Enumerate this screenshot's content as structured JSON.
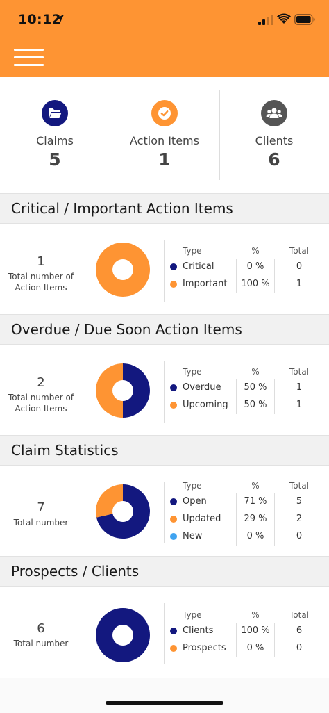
{
  "status_bar": {
    "time": "10:12"
  },
  "colors": {
    "header": "#fe9433",
    "navy": "#13187f",
    "orange": "#fe9433",
    "light_blue": "#3fa3f0",
    "gray_icon": "#555555"
  },
  "summary": [
    {
      "label": "Claims",
      "value": "5",
      "icon": "folder-open-icon"
    },
    {
      "label": "Action Items",
      "value": "1",
      "icon": "check-circle-icon"
    },
    {
      "label": "Clients",
      "value": "6",
      "icon": "users-icon"
    }
  ],
  "sections": [
    {
      "title": "Critical / Important Action Items",
      "total": "1",
      "total_label": [
        "Total number of",
        "Action Items"
      ],
      "table_headers": {
        "type": "Type",
        "pct": "%",
        "total": "Total"
      },
      "rows": [
        {
          "type": "Critical",
          "pct": "0 %",
          "total": "0",
          "color": "#13187f"
        },
        {
          "type": "Important",
          "pct": "100 %",
          "total": "1",
          "color": "#fe9433"
        }
      ]
    },
    {
      "title": "Overdue / Due Soon Action Items",
      "total": "2",
      "total_label": [
        "Total number of",
        "Action Items"
      ],
      "table_headers": {
        "type": "Type",
        "pct": "%",
        "total": "Total"
      },
      "rows": [
        {
          "type": "Overdue",
          "pct": "50 %",
          "total": "1",
          "color": "#13187f"
        },
        {
          "type": "Upcoming",
          "pct": "50 %",
          "total": "1",
          "color": "#fe9433"
        }
      ]
    },
    {
      "title": "Claim Statistics",
      "total": "7",
      "total_label": [
        "Total number"
      ],
      "table_headers": {
        "type": "Type",
        "pct": "%",
        "total": "Total"
      },
      "rows": [
        {
          "type": "Open",
          "pct": "71 %",
          "total": "5",
          "color": "#13187f"
        },
        {
          "type": "Updated",
          "pct": "29 %",
          "total": "2",
          "color": "#fe9433"
        },
        {
          "type": "New",
          "pct": "0 %",
          "total": "0",
          "color": "#3fa3f0"
        }
      ]
    },
    {
      "title": "Prospects / Clients",
      "total": "6",
      "total_label": [
        "Total number"
      ],
      "table_headers": {
        "type": "Type",
        "pct": "%",
        "total": "Total"
      },
      "rows": [
        {
          "type": "Clients",
          "pct": "100 %",
          "total": "6",
          "color": "#13187f"
        },
        {
          "type": "Prospects",
          "pct": "0 %",
          "total": "0",
          "color": "#fe9433"
        }
      ]
    }
  ],
  "chart_data": [
    {
      "type": "pie",
      "donut": true,
      "labels": [
        "Critical",
        "Important"
      ],
      "values": [
        0,
        1
      ],
      "colors": [
        "#13187f",
        "#fe9433"
      ]
    },
    {
      "type": "pie",
      "donut": true,
      "labels": [
        "Overdue",
        "Upcoming"
      ],
      "values": [
        1,
        1
      ],
      "colors": [
        "#13187f",
        "#fe9433"
      ]
    },
    {
      "type": "pie",
      "donut": true,
      "labels": [
        "Open",
        "Updated",
        "New"
      ],
      "values": [
        5,
        2,
        0
      ],
      "colors": [
        "#13187f",
        "#fe9433",
        "#3fa3f0"
      ]
    },
    {
      "type": "pie",
      "donut": true,
      "labels": [
        "Clients",
        "Prospects"
      ],
      "values": [
        6,
        0
      ],
      "colors": [
        "#13187f",
        "#fe9433"
      ]
    }
  ]
}
